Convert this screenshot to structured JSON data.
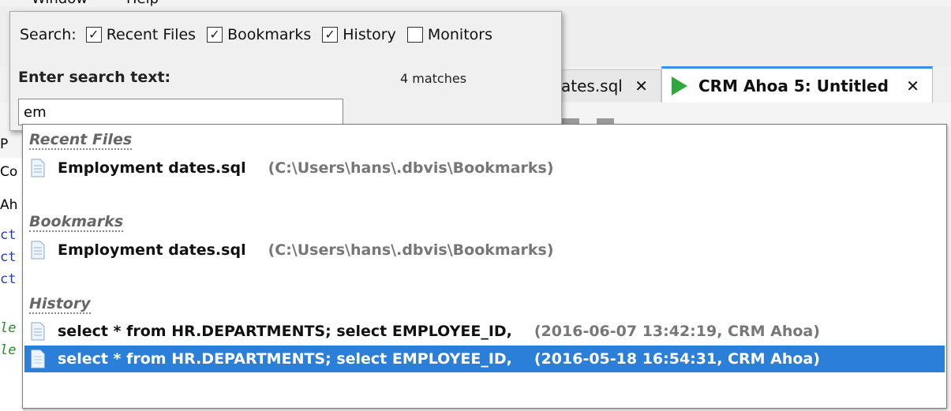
{
  "menubar": {
    "items": [
      "Window",
      "Help"
    ]
  },
  "tabs": {
    "inactive": {
      "label": "ates.sql"
    },
    "active": {
      "label": "CRM Ahoa 5: Untitled"
    },
    "close_glyph": "✕"
  },
  "background_fragments": {
    "f1": "P",
    "f2": "Co",
    "f3": "Ah",
    "code": [
      "ct",
      "ct",
      "ct",
      "le",
      "le"
    ]
  },
  "search": {
    "label": "Search:",
    "options": [
      {
        "label": "Recent Files",
        "checked": true
      },
      {
        "label": "Bookmarks",
        "checked": true
      },
      {
        "label": "History",
        "checked": true
      },
      {
        "label": "Monitors",
        "checked": false
      }
    ],
    "enter_label": "Enter search text:",
    "matches": "4 matches",
    "query": "em"
  },
  "results": {
    "sections": [
      {
        "header": "Recent Files",
        "items": [
          {
            "title": "Employment dates.sql",
            "meta": "(C:\\Users\\hans\\.dbvis\\Bookmarks)"
          }
        ]
      },
      {
        "header": "Bookmarks",
        "items": [
          {
            "title": "Employment dates.sql",
            "meta": "(C:\\Users\\hans\\.dbvis\\Bookmarks)"
          }
        ]
      },
      {
        "header": "History",
        "items": [
          {
            "title": "select * from HR.DEPARTMENTS; select EMPLOYEE_ID,",
            "meta": "(2016-06-07 13:42:19,  CRM Ahoa)"
          },
          {
            "title": "select * from HR.DEPARTMENTS; select EMPLOYEE_ID,",
            "meta": "(2016-05-18 16:54:31,  CRM Ahoa)",
            "selected": true
          }
        ]
      }
    ]
  },
  "colors": {
    "selection": "#2b7fd8",
    "tab_accent": "#3d8ee6",
    "run_icon": "#2eaa3c"
  }
}
